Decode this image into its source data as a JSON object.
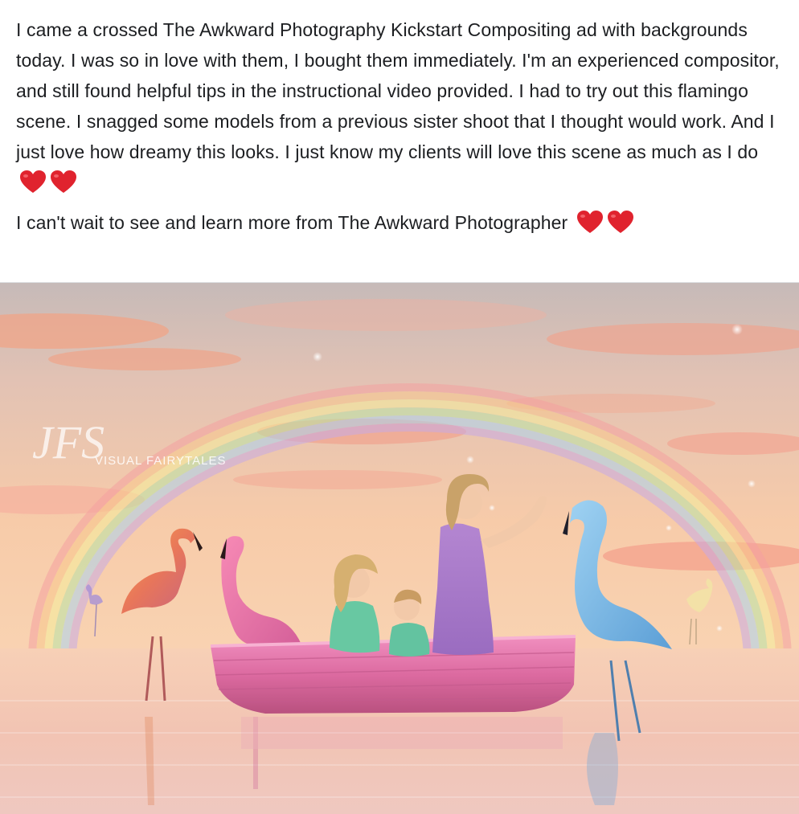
{
  "post": {
    "paragraph_1": "I came a crossed The Awkward Photography Kickstart Compositing ad with backgrounds today. I was so in love with them, I bought them immediately. I'm an experienced compositor, and still found helpful tips in the instructional video provided. I had to try out this flamingo scene. I snagged some models from a previous sister shoot that I thought would work. And I just love how dreamy this looks. I just know my clients will love this scene as much as I do",
    "paragraph_2": "I can't wait to see and learn more from The Awkward Photographer",
    "emoji": "red-heart-icon"
  },
  "photo": {
    "watermark_monogram": "JFS",
    "watermark_text": "VISUAL FAIRYTALES"
  },
  "colors": {
    "text": "#1c1e21",
    "heart": "#e0232e",
    "sky_top": "#c9b9b6",
    "sky_mid": "#f6c7a6",
    "water": "#f2c9b6",
    "boat": "#e06fa4"
  }
}
